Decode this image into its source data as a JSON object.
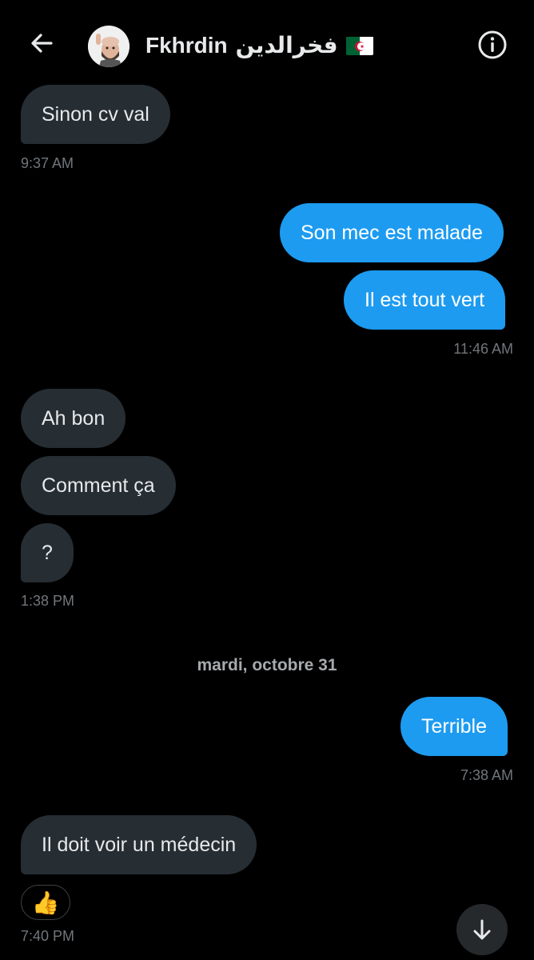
{
  "header": {
    "contact_name": "Fkhrdin",
    "contact_name_arabic": "فخرالدين",
    "flag_icon": "algeria-flag-icon",
    "back_icon": "arrow-left-icon",
    "info_icon": "info-icon",
    "avatar_icon": "memoji-avatar"
  },
  "messages": [
    {
      "text": "Sinon cv val",
      "side": "in"
    },
    {
      "text": "Son mec est malade",
      "side": "out"
    },
    {
      "text": "Il est tout vert",
      "side": "out"
    },
    {
      "text": "Ah bon",
      "side": "in"
    },
    {
      "text": "Comment ça",
      "side": "in"
    },
    {
      "text": "?",
      "side": "in"
    },
    {
      "text": "Terrible",
      "side": "out"
    },
    {
      "text": "Il doit voir un médecin",
      "side": "in"
    }
  ],
  "timestamps": [
    "9:37 AM",
    "11:46 AM",
    "1:38 PM",
    "7:38 AM",
    "7:40 PM"
  ],
  "date_separator": "mardi, octobre 31",
  "reaction": {
    "emoji": "👍"
  },
  "scroll_button_icon": "arrow-down-icon",
  "colors": {
    "background": "#000000",
    "incoming_bubble": "#262d33",
    "outgoing_bubble": "#1d9bf0",
    "timestamp": "#71767b"
  }
}
